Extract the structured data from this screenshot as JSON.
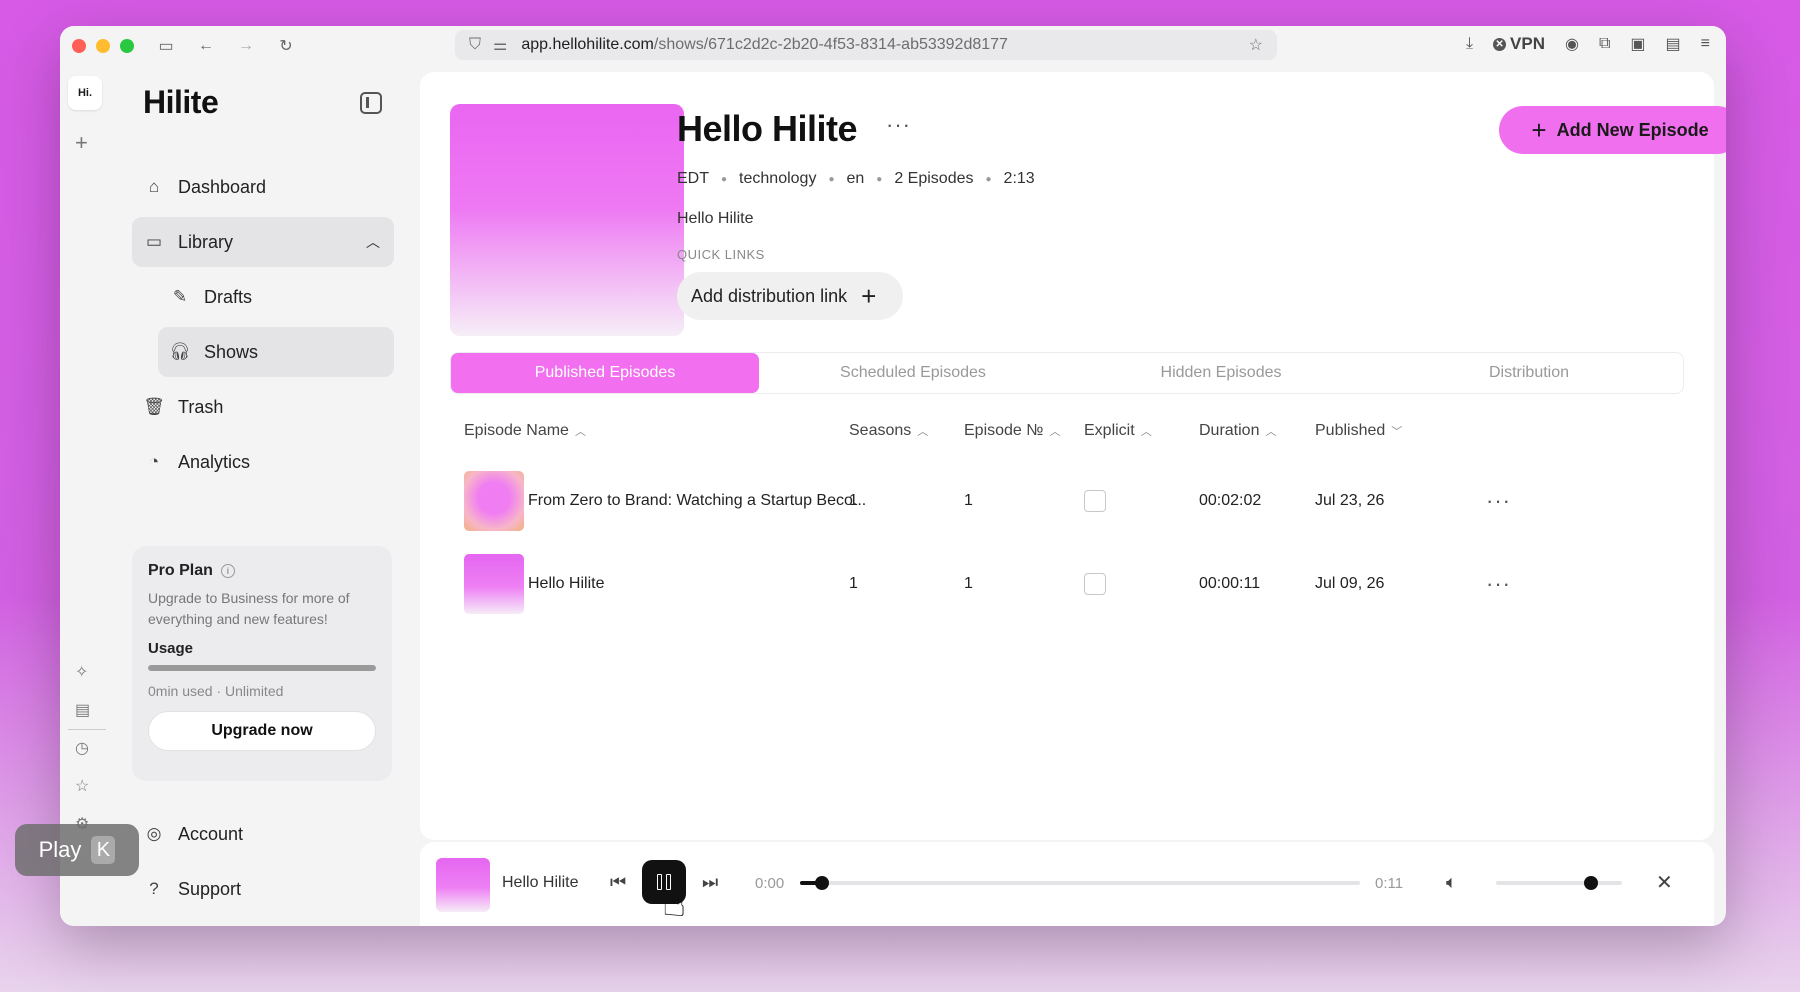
{
  "browser": {
    "url_domain": "app.hellohilite.com",
    "url_path": "/shows/671c2d2c-2b20-4f53-8314-ab53392d8177",
    "vpn_label": "VPN"
  },
  "rail": {
    "logo": "Hi."
  },
  "sidebar": {
    "brand": "Hilite",
    "items": {
      "dashboard": "Dashboard",
      "library": "Library",
      "drafts": "Drafts",
      "shows": "Shows",
      "trash": "Trash",
      "analytics": "Analytics",
      "account": "Account",
      "support": "Support"
    },
    "plan": {
      "title": "Pro Plan",
      "description": "Upgrade to Business for more of everything and new features!",
      "usage_label": "Usage",
      "usage_text": "0min used · Unlimited",
      "upgrade_label": "Upgrade now"
    }
  },
  "show": {
    "title": "Hello Hilite",
    "meta": {
      "timezone": "EDT",
      "category": "technology",
      "language": "en",
      "episodes": "2 Episodes",
      "duration": "2:13"
    },
    "description": "Hello Hilite",
    "quick_links_label": "QUICK LINKS",
    "add_distribution_label": "Add distribution link",
    "add_episode_label": "Add New Episode"
  },
  "tabs": [
    "Published Episodes",
    "Scheduled Episodes",
    "Hidden Episodes",
    "Distribution"
  ],
  "table": {
    "headers": {
      "name": "Episode Name",
      "seasons": "Seasons",
      "episode_no": "Episode №",
      "explicit": "Explicit",
      "duration": "Duration",
      "published": "Published"
    },
    "rows": [
      {
        "name": "From Zero to Brand: Watching a Startup Beco...",
        "season": "1",
        "episode": "1",
        "duration": "00:02:02",
        "published": "Jul 23, 26"
      },
      {
        "name": "Hello Hilite",
        "season": "1",
        "episode": "1",
        "duration": "00:00:11",
        "published": "Jul 09, 26"
      }
    ]
  },
  "player": {
    "title": "Hello Hilite",
    "time_current": "0:00",
    "time_total": "0:11",
    "progress": 0.02,
    "volume": 0.75
  },
  "tooltip": {
    "label": "Play",
    "key": "K"
  },
  "colors": {
    "accent": "#f06fef",
    "background": "#d65ae6"
  }
}
